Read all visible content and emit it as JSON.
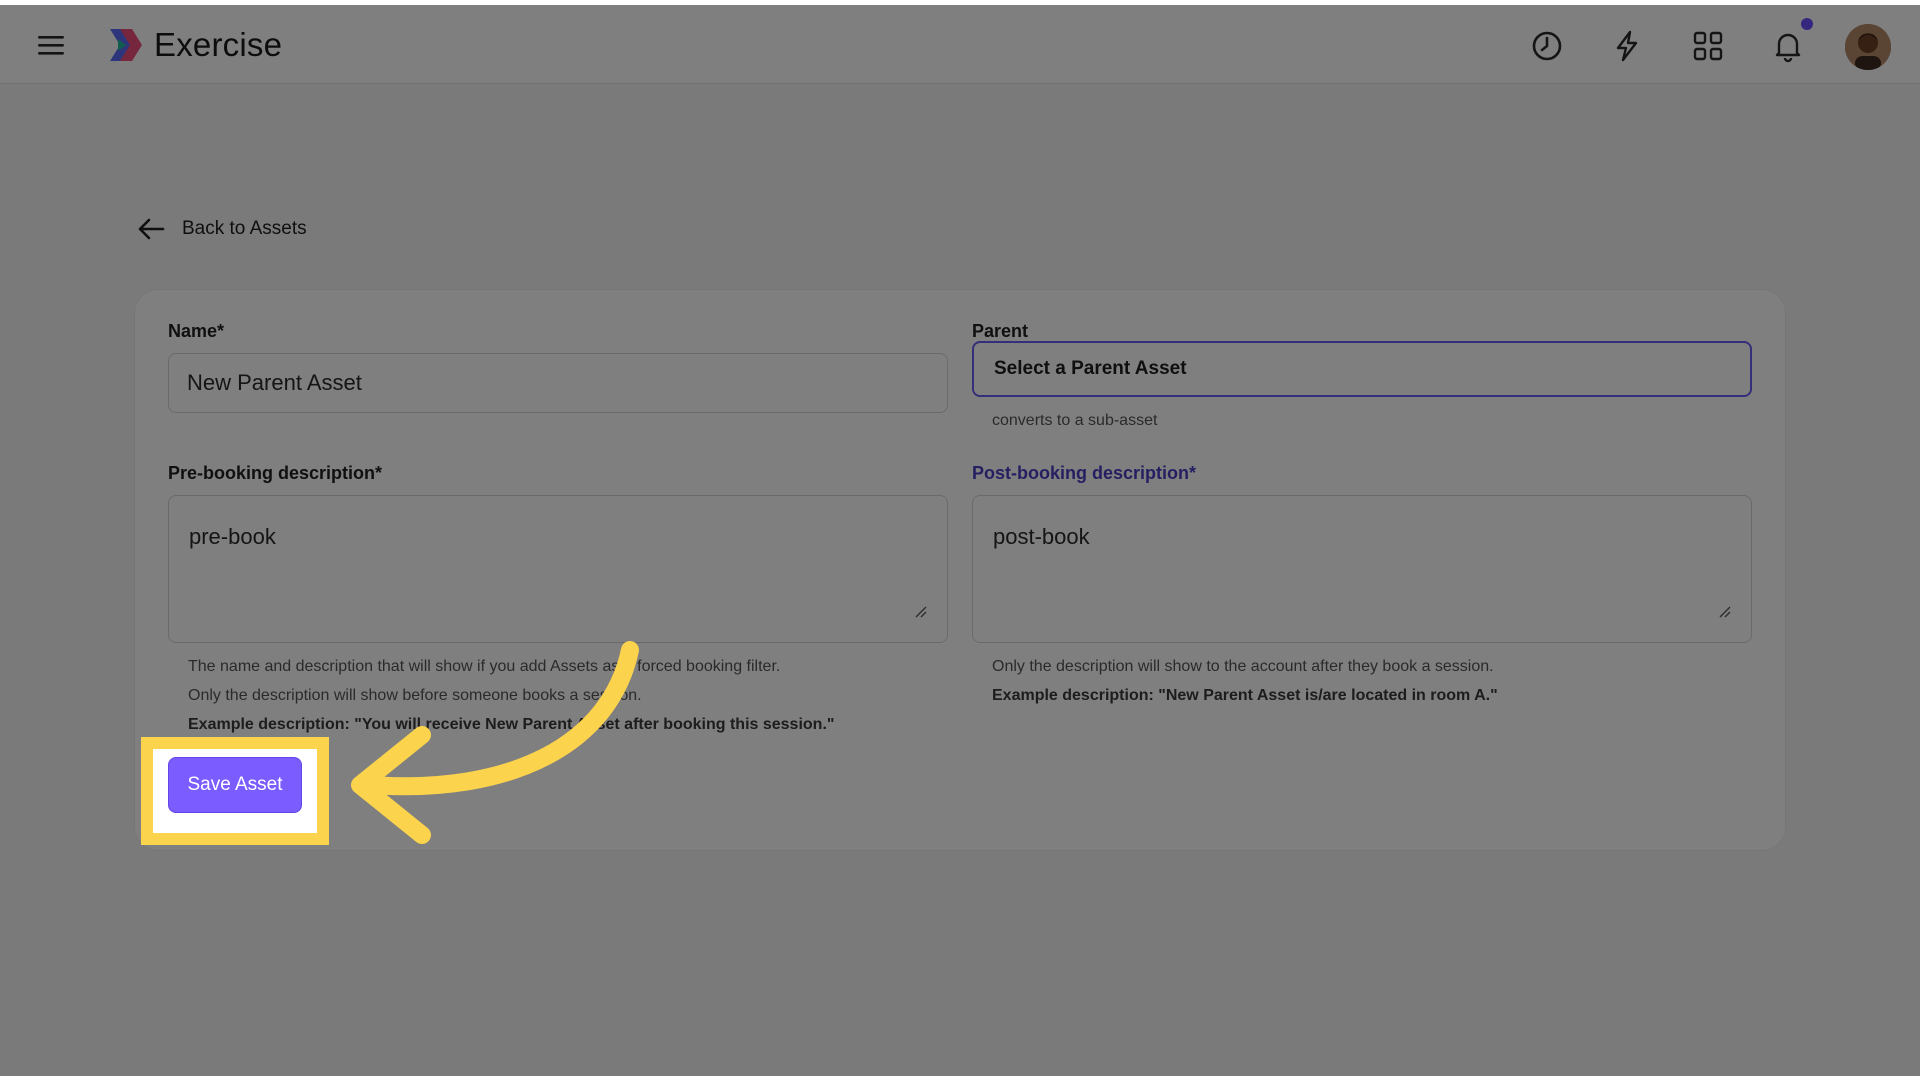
{
  "header": {
    "app_title": "Exercise",
    "icons": [
      "menu-icon",
      "logo-icon",
      "history-icon",
      "lightning-icon",
      "apps-grid-icon",
      "bell-icon",
      "avatar"
    ],
    "accent_color": "#6b4dff"
  },
  "back_link": {
    "label": "Back to Assets"
  },
  "form": {
    "name": {
      "label": "Name*",
      "value": "New Parent Asset"
    },
    "parent": {
      "label": "Parent",
      "value": "Select a Parent Asset",
      "hint": "converts to a sub-asset"
    },
    "pre_booking": {
      "label": "Pre-booking description*",
      "value": "pre-book",
      "hints": [
        "The name and description that will show if you add Assets as a forced booking filter.",
        "Only the description will show before someone books a session."
      ],
      "example": "Example description: \"You will receive New Parent Asset after booking this session.\""
    },
    "post_booking": {
      "label": "Post-booking description*",
      "value": "post-book",
      "hints": [
        "Only the description will show to the account after they book a session."
      ],
      "example": "Example description: \"New Parent Asset is/are located in room A.\""
    },
    "save_label": "Save Asset"
  },
  "overlay": {
    "highlight_color": "#fcd34d"
  }
}
